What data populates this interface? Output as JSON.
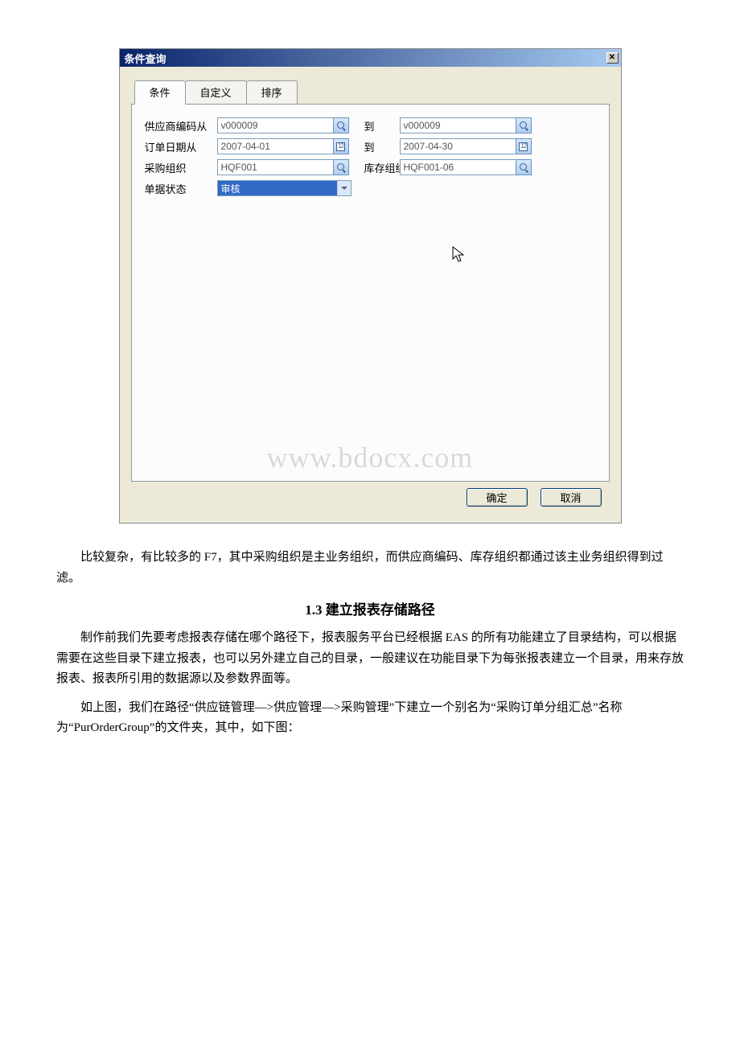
{
  "dialog": {
    "title": "条件查询",
    "tabs": [
      "条件",
      "自定义",
      "排序"
    ],
    "form": {
      "supplier_from_label": "供应商编码从",
      "supplier_from_value": "v000009",
      "supplier_to_label": "到",
      "supplier_to_value": "v000009",
      "order_date_from_label": "订单日期从",
      "order_date_from_value": "2007-04-01",
      "order_date_to_label": "到",
      "order_date_to_value": "2007-04-30",
      "purchase_org_label": "采购组织",
      "purchase_org_value": "HQF001",
      "stock_org_label": "库存组织",
      "stock_org_value": "HQF001-06",
      "status_label": "单据状态",
      "status_value": "审核"
    },
    "watermark": "www.bdocx.com",
    "ok_label": "确定",
    "cancel_label": "取消"
  },
  "doc": {
    "p1": "比较复杂，有比较多的 F7，其中采购组织是主业务组织，而供应商编码、库存组织都通过该主业务组织得到过滤。",
    "h1": "1.3 建立报表存储路径",
    "p2": "制作前我们先要考虑报表存储在哪个路径下，报表服务平台已经根据 EAS 的所有功能建立了目录结构，可以根据需要在这些目录下建立报表，也可以另外建立自己的目录，一般建议在功能目录下为每张报表建立一个目录，用来存放报表、报表所引用的数据源以及参数界面等。",
    "p3": "如上图，我们在路径“供应链管理—>供应管理—>采购管理”下建立一个别名为“采购订单分组汇总”名称为“PurOrderGroup”的文件夹，其中，如下图："
  }
}
